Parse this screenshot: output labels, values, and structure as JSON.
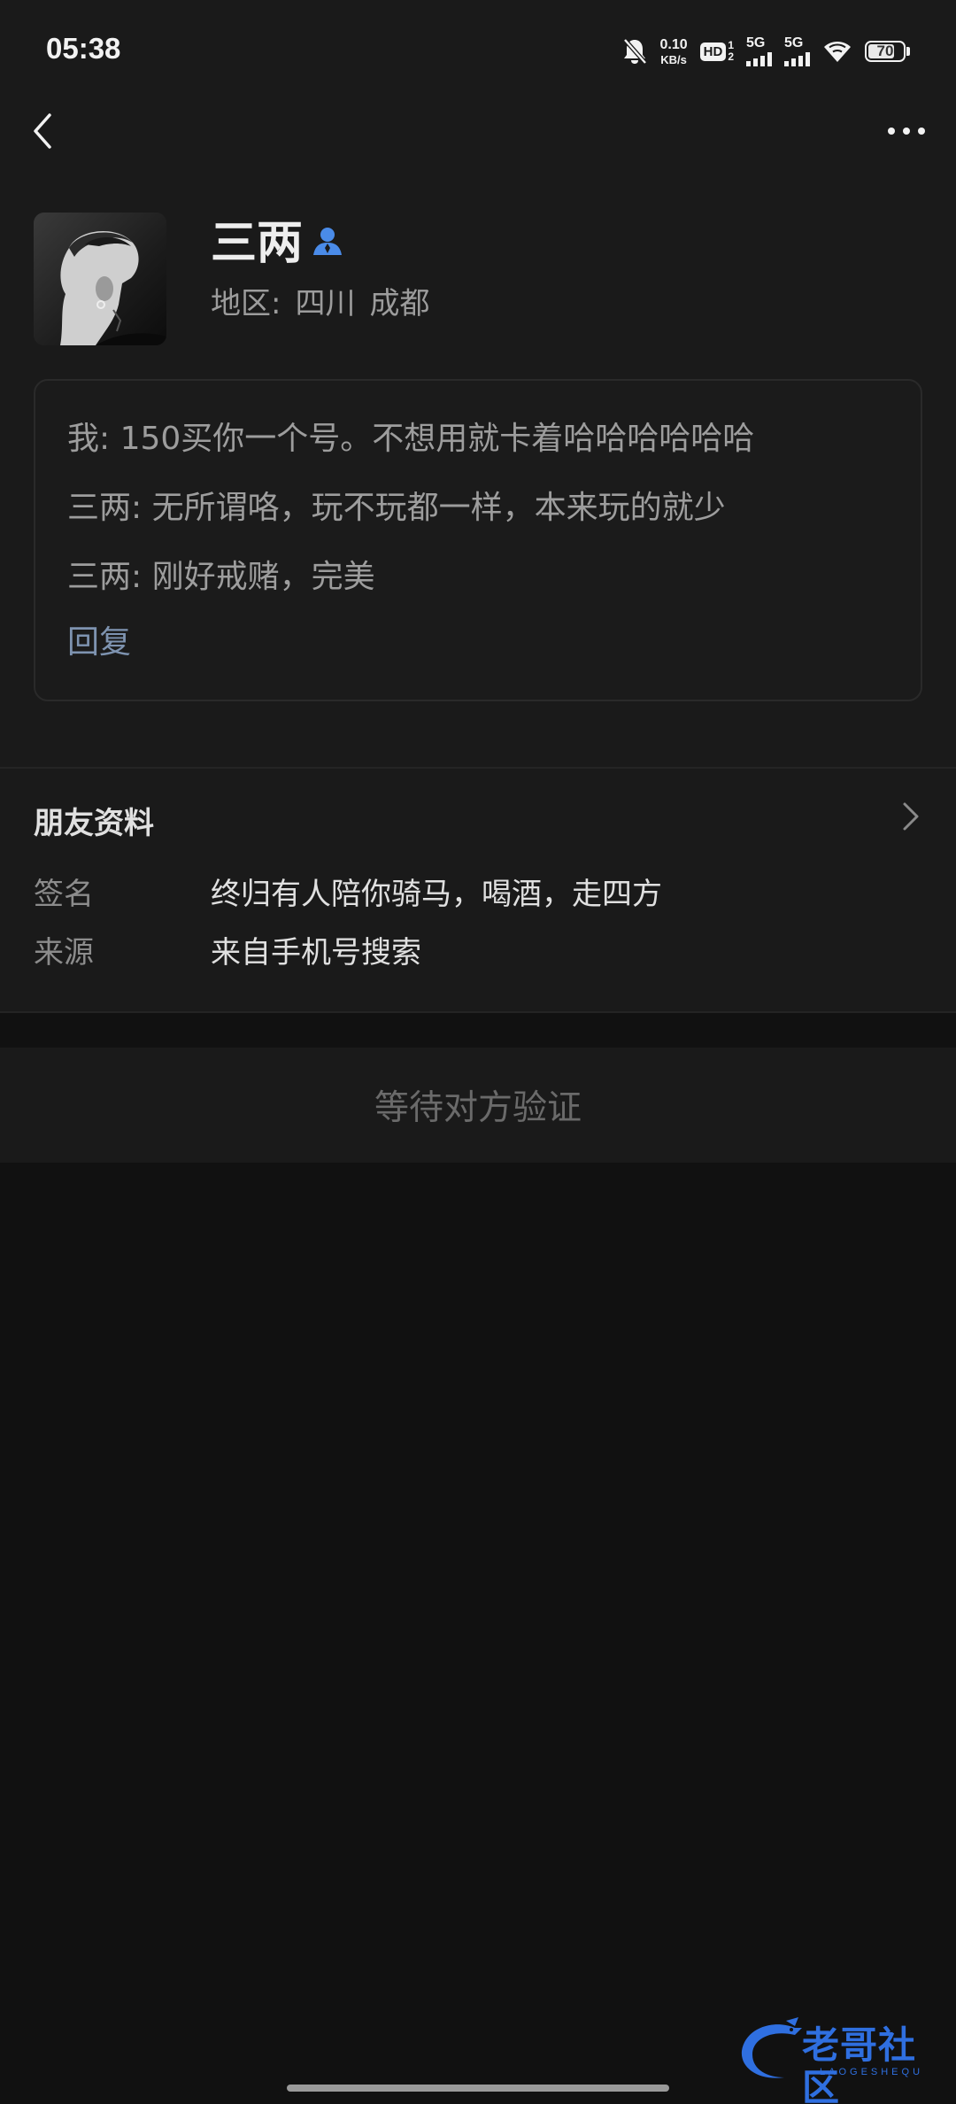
{
  "status_bar": {
    "time": "05:38",
    "net_speed_value": "0.10",
    "net_speed_unit": "KB/s",
    "hd_label": "HD",
    "hd_top": "1",
    "hd_bottom": "2",
    "sim1_label": "5G",
    "sim2_label": "5G",
    "battery": "70",
    "icons": [
      "bell-off-icon",
      "hd-icon",
      "signal-icon",
      "signal-icon",
      "wifi-icon",
      "battery-icon"
    ]
  },
  "nav": {
    "back_icon": "chevron-left-icon",
    "more_icon": "more-dots-icon"
  },
  "profile": {
    "name": "三两",
    "verified_icon": "contact-person-icon",
    "region_label": "地区:",
    "region_province": "四川",
    "region_city": "成都"
  },
  "messages": {
    "lines": [
      "我: 150买你一个号。不想用就卡着哈哈哈哈哈哈",
      "三两: 无所谓咯，玩不玩都一样，本来玩的就少",
      "三两: 刚好戒赌，完美"
    ],
    "reply_label": "回复"
  },
  "friend_info": {
    "title": "朋友资料",
    "rows": [
      {
        "label": "签名",
        "value": "终归有人陪你骑马，喝酒，走四方"
      },
      {
        "label": "来源",
        "value": "来自手机号搜索"
      }
    ]
  },
  "action": {
    "waiting_label": "等待对方验证"
  },
  "watermark": {
    "text": "老哥社区",
    "sub": "LAOGESHEQU"
  },
  "colors": {
    "background": "#111111",
    "panel": "#1a1a1a",
    "accent_link": "#7e93b0",
    "contact_icon": "#4a8be8",
    "watermark": "#2f6fe0"
  }
}
